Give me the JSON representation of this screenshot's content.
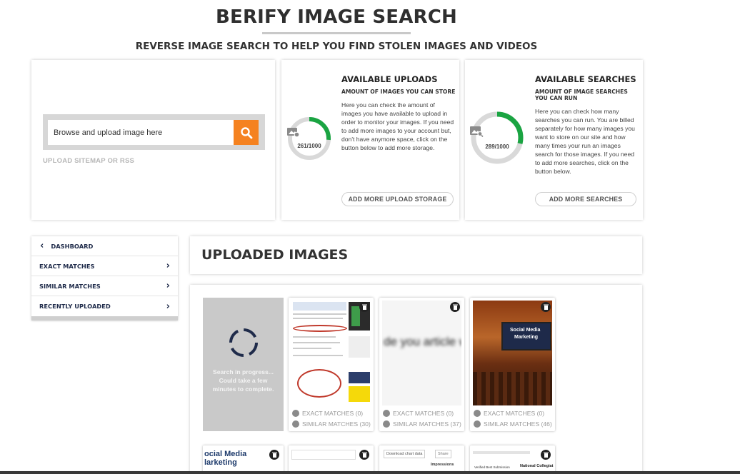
{
  "header": {
    "title": "BERIFY IMAGE SEARCH",
    "subtitle": "REVERSE IMAGE SEARCH TO HELP YOU FIND STOLEN IMAGES AND VIDEOS"
  },
  "upload": {
    "input_value": "Browse and upload image here",
    "search_icon": "search-icon",
    "sitemap_link": "UPLOAD SITEMAP OR RSS"
  },
  "uploads_card": {
    "title": "AVAILABLE UPLOADS",
    "subtitle": "AMOUNT OF IMAGES YOU CAN STORE",
    "description": "Here you can check the amount of images you have available to upload in order to monitor your images. If you need to add more images to your account but, don't have anymore space, click on the button below to add more storage.",
    "count": "261/1000",
    "used": 261,
    "total": 1000,
    "button": "ADD MORE UPLOAD STORAGE",
    "icon": "image-upload-icon"
  },
  "searches_card": {
    "title": "AVAILABLE SEARCHES",
    "subtitle": "AMOUNT OF IMAGE SEARCHES YOU CAN RUN",
    "description": "Here you can check how many searches you can run. You are billed separately for how many images you want to store on our site and how many times your run an images search for those images. If you need to add more searches, click on the button below.",
    "count": "289/1000",
    "used": 289,
    "total": 1000,
    "button": "ADD MORE SEARCHES",
    "icon": "image-search-icon"
  },
  "sidebar": {
    "items": [
      {
        "label": "DASHBOARD",
        "icon": "chevron-left-icon"
      },
      {
        "label": "EXACT MATCHES",
        "icon": "chevron-right-icon"
      },
      {
        "label": "SIMILAR MATCHES",
        "icon": "chevron-right-icon"
      },
      {
        "label": "RECENTLY UPLOADED",
        "icon": "chevron-right-icon"
      }
    ]
  },
  "main": {
    "section_title": "UPLOADED IMAGES",
    "pending": {
      "text": "Search in progress... Could take a few minutes to complete."
    },
    "thumbs": [
      {
        "exact": "EXACT MATCHES (0)",
        "similar": "SIMILAR MATCHES (30)"
      },
      {
        "exact": "EXACT MATCHES (0)",
        "similar": "SIMILAR MATCHES (37)"
      },
      {
        "exact": "EXACT MATCHES (0)",
        "similar": "SIMILAR MATCHES (46)"
      }
    ],
    "thumb_texts": {
      "blurred_text": "de you article wi",
      "banner_line1": "Social Media",
      "banner_line2": "Marketing",
      "bottom_1_line1": "ocial Media",
      "bottom_1_line2": "larketing",
      "bottom_3_btn": "Download chart data",
      "bottom_3_label": "Impressions",
      "bottom_3_small": "Share",
      "bottom_4_a": "Verified Best Submission",
      "bottom_4_b": "National Collegiat"
    }
  },
  "colors": {
    "accent_orange": "#f58220",
    "ring_green": "#1aa442",
    "ring_track": "#d9d9d9",
    "nav_text": "#1f2b4a"
  }
}
